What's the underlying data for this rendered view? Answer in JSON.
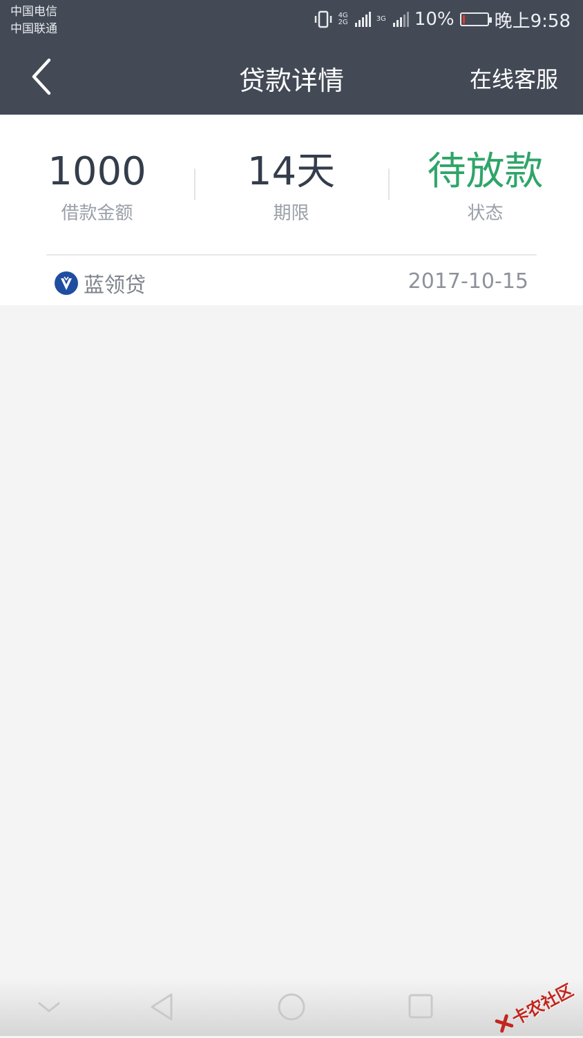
{
  "status_bar": {
    "carrier_1": "中国电信",
    "carrier_2": "中国联通",
    "network_tag_1": "4G",
    "network_tag_2": "2G",
    "network_tag_3": "3G",
    "battery_percent": "10%",
    "time": "晚上9:58",
    "battery_level": 0.1,
    "battery_color": "#e8372c"
  },
  "header": {
    "title": "贷款详情",
    "back_icon": "chevron-left-icon",
    "service_label": "在线客服"
  },
  "summary": {
    "amount": {
      "value": "1000",
      "label": "借款金额"
    },
    "term": {
      "value": "14天",
      "label": "期限"
    },
    "status": {
      "value": "待放款",
      "label": "状态",
      "color": "#2fa569"
    }
  },
  "product": {
    "name": "蓝领贷",
    "date": "2017-10-15",
    "logo_icon": "bluecollar-loan-logo-icon"
  },
  "bottom_nav": {
    "icons": [
      "chevron-down-icon",
      "back-triangle-icon",
      "home-circle-icon",
      "recents-square-icon"
    ]
  },
  "watermark": {
    "text": "卡农社区"
  },
  "colors": {
    "header_bg": "#434a56",
    "page_bg": "#f4f4f4",
    "accent_green": "#2fa569",
    "logo_blue": "#1f4ea1"
  }
}
